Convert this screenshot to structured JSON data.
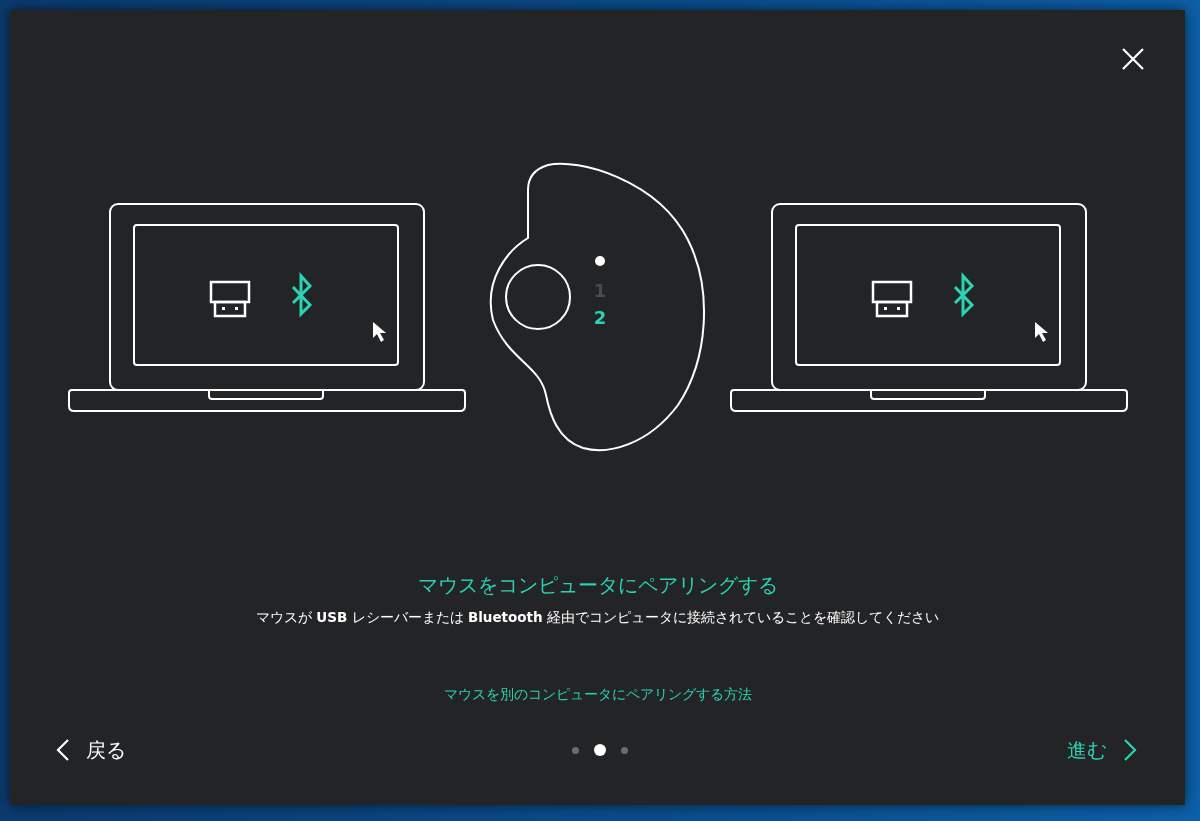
{
  "mouse": {
    "channels": [
      {
        "label": "1",
        "selected": false
      },
      {
        "label": "2",
        "selected": true
      }
    ]
  },
  "title": "マウスをコンピュータにペアリングする",
  "description": "マウスが **USB** レシーバーまたは **Bluetooth** 経由でコンピュータに接続されていることを確認してください",
  "help_link": "マウスを別のコンピュータにペアリングする方法",
  "back_button": "戻る",
  "next_button": "進む",
  "page_dots": [
    {
      "selected": false
    },
    {
      "selected": true
    },
    {
      "selected": false
    }
  ]
}
